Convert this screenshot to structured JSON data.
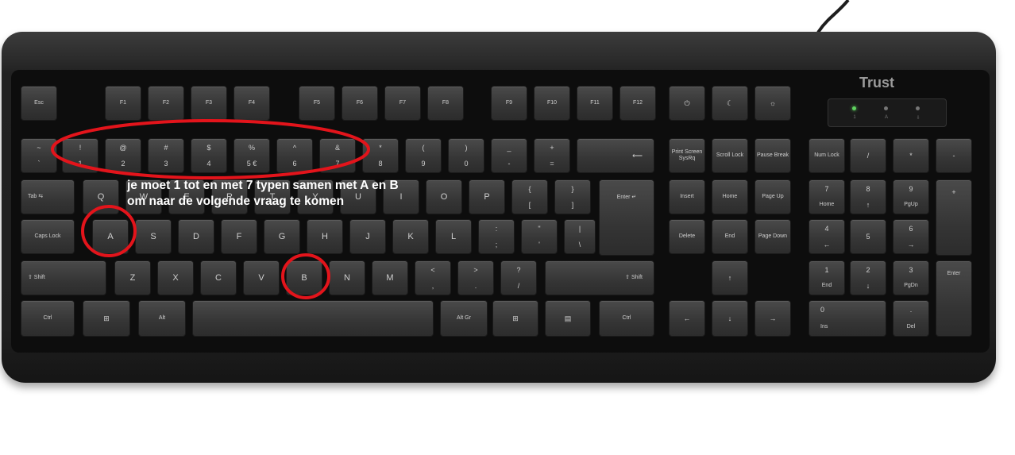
{
  "brand": "Trust",
  "annotation": "je moet 1 tot en met 7 typen samen met A en B om naar de volgende vraag te komen",
  "highlight_color": "#e3141b",
  "leds": [
    {
      "label": "1",
      "on": true
    },
    {
      "label": "A",
      "on": false
    },
    {
      "label": "⇩",
      "on": false
    }
  ],
  "keys": {
    "esc": "Esc",
    "f1": "F1",
    "f2": "F2",
    "f3": "F3",
    "f4": "F4",
    "f5": "F5",
    "f6": "F6",
    "f7": "F7",
    "f8": "F8",
    "f9": "F9",
    "f10": "F10",
    "f11": "F11",
    "f12": "F12",
    "power": "⏻",
    "sleep": "☾",
    "wake": "☼",
    "tilde_top": "~",
    "tilde_bot": "`",
    "n1_top": "!",
    "n1_bot": "1",
    "n2_top": "@",
    "n2_bot": "2",
    "n3_top": "#",
    "n3_bot": "3",
    "n4_top": "$",
    "n4_bot": "4",
    "n5_top": "%",
    "n5_bot": "5 €",
    "n6_top": "^",
    "n6_bot": "6",
    "n7_top": "&",
    "n7_bot": "7",
    "n8_top": "*",
    "n8_bot": "8",
    "n9_top": "(",
    "n9_bot": "9",
    "n0_top": ")",
    "n0_bot": "0",
    "minus_top": "_",
    "minus_bot": "-",
    "equal_top": "+",
    "equal_bot": "=",
    "backspace": "⟵",
    "tab": "Tab ⇆",
    "q": "Q",
    "w": "W",
    "e": "E",
    "r": "R",
    "t": "T",
    "y": "Y",
    "u": "U",
    "i": "I",
    "o": "O",
    "p": "P",
    "lbrace_top": "{",
    "lbrace_bot": "[",
    "rbrace_top": "}",
    "rbrace_bot": "]",
    "enter": "Enter ↵",
    "caps": "Caps Lock",
    "a": "A",
    "s": "S",
    "d": "D",
    "f": "F",
    "g": "G",
    "h": "H",
    "j": "J",
    "k": "K",
    "l": "L",
    "semi_top": ":",
    "semi_bot": ";",
    "quote_top": "\"",
    "quote_bot": "'",
    "bslash_top": "|",
    "bslash_bot": "\\",
    "lshift": "⇧ Shift",
    "z": "Z",
    "x": "X",
    "c": "C",
    "v": "V",
    "b": "B",
    "n": "N",
    "m": "M",
    "comma_top": "<",
    "comma_bot": ",",
    "period_top": ">",
    "period_bot": ".",
    "slash_top": "?",
    "slash_bot": "/",
    "rshift": "⇧ Shift",
    "lctrl": "Ctrl",
    "lwin": "⊞",
    "alt": "Alt",
    "altgr": "Alt Gr",
    "rwin": "⊞",
    "menu": "▤",
    "rctrl": "Ctrl",
    "prtsc": "Print Screen SysRq",
    "scroll": "Scroll Lock",
    "pause": "Pause Break",
    "insert": "Insert",
    "home": "Home",
    "pgup": "Page Up",
    "delete": "Delete",
    "end": "End",
    "pgdn": "Page Down",
    "up": "↑",
    "left": "←",
    "down": "↓",
    "right": "→",
    "numlock": "Num Lock",
    "np_div": "/",
    "np_mul": "*",
    "np_minus": "-",
    "np_plus": "+",
    "np7_top": "7",
    "np7_bot": "Home",
    "np8_top": "8",
    "np8_bot": "↑",
    "np9_top": "9",
    "np9_bot": "PgUp",
    "np4_top": "4",
    "np4_bot": "←",
    "np5": "5",
    "np6_top": "6",
    "np6_bot": "→",
    "np1_top": "1",
    "np1_bot": "End",
    "np2_top": "2",
    "np2_bot": "↓",
    "np3_top": "3",
    "np3_bot": "PgDn",
    "np0_top": "0",
    "np0_bot": "Ins",
    "npdot_top": ".",
    "npdot_bot": "Del",
    "np_enter": "Enter"
  }
}
